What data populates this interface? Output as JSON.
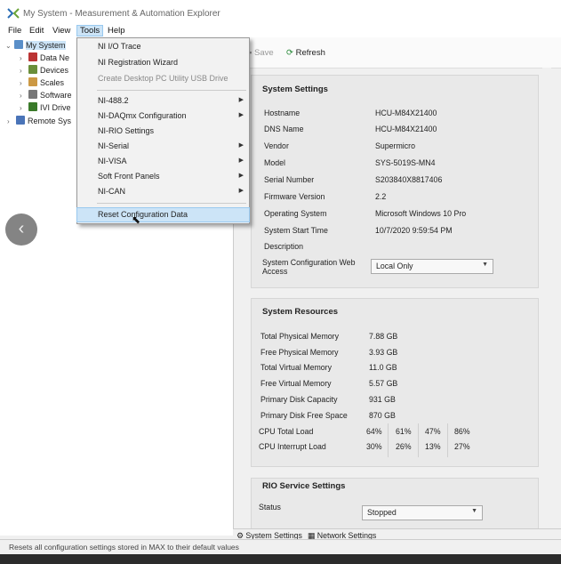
{
  "titlebar": {
    "title": "My System - Measurement & Automation Explorer"
  },
  "menubar": {
    "items": [
      "File",
      "Edit",
      "View",
      "Tools",
      "Help"
    ]
  },
  "tree": {
    "root": "My System",
    "children": [
      "Data Ne",
      "Devices",
      "Scales",
      "Software",
      "IVI Drive"
    ],
    "remote": "Remote Sys"
  },
  "tools_menu": {
    "items": [
      {
        "label": "NI I/O Trace"
      },
      {
        "label": "NI Registration Wizard"
      },
      {
        "label": "Create Desktop PC Utility USB Drive"
      },
      {
        "label": "NI-488.2"
      },
      {
        "label": "NI-DAQmx Configuration"
      },
      {
        "label": "NI-RIO Settings"
      },
      {
        "label": "NI-Serial"
      },
      {
        "label": "NI-VISA"
      },
      {
        "label": "Soft Front Panels"
      },
      {
        "label": "NI-CAN"
      },
      {
        "label": "Reset Configuration Data"
      }
    ]
  },
  "toolbar": {
    "save_label": "Save",
    "refresh_label": "Refresh"
  },
  "system_settings": {
    "title": "System Settings",
    "rows": [
      {
        "label": "Hostname",
        "value": "HCU-M84X21400"
      },
      {
        "label": "DNS Name",
        "value": "HCU-M84X21400"
      },
      {
        "label": "Vendor",
        "value": "Supermicro"
      },
      {
        "label": "Model",
        "value": "SYS-5019S-MN4"
      },
      {
        "label": "Serial Number",
        "value": "S203840X8817406"
      },
      {
        "label": "Firmware Version",
        "value": "2.2"
      },
      {
        "label": "Operating System",
        "value": "Microsoft Windows 10 Pro"
      },
      {
        "label": "System Start Time",
        "value": "10/7/2020 9:59:54 PM"
      },
      {
        "label": "Description",
        "value": ""
      }
    ],
    "web_access_label_1": "System Configuration Web",
    "web_access_label_2": "Access",
    "web_access_value": "Local Only"
  },
  "system_resources": {
    "title": "System Resources",
    "rows": [
      {
        "label": "Total Physical Memory",
        "value": "7.88 GB"
      },
      {
        "label": "Free Physical Memory",
        "value": "3.93 GB"
      },
      {
        "label": "Total Virtual Memory",
        "value": "11.0 GB"
      },
      {
        "label": "Free Virtual Memory",
        "value": "5.57 GB"
      },
      {
        "label": "Primary Disk Capacity",
        "value": "931 GB"
      },
      {
        "label": "Primary Disk Free Space",
        "value": "870 GB"
      }
    ],
    "cpu_total_label": "CPU Total Load",
    "cpu_total": [
      "64%",
      "61%",
      "47%",
      "86%"
    ],
    "cpu_interrupt_label": "CPU Interrupt Load",
    "cpu_interrupt": [
      "30%",
      "26%",
      "13%",
      "27%"
    ]
  },
  "rio_settings": {
    "title": "RIO Service Settings",
    "status_label": "Status",
    "status_value": "Stopped"
  },
  "bottom_tabs": {
    "system_settings": "System Settings",
    "network_settings": "Network Settings"
  },
  "statusbar": {
    "text": "Resets all configuration settings stored in MAX to their default values"
  }
}
